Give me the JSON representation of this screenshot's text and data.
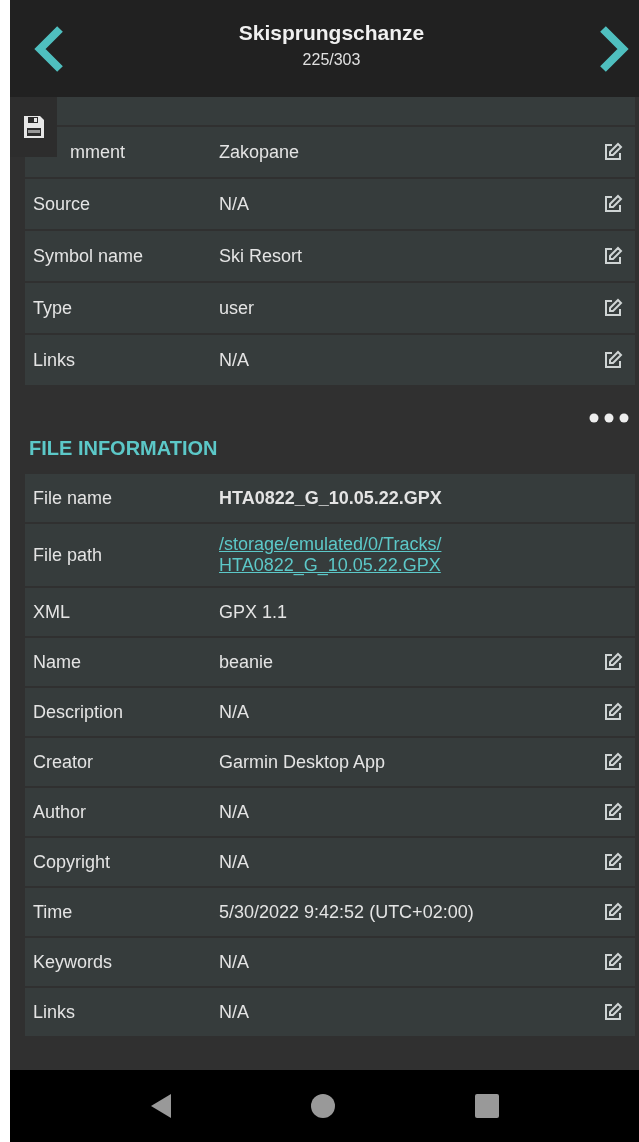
{
  "header": {
    "title": "Skisprungschanze",
    "counter": "225/303"
  },
  "waypoint_rows": [
    {
      "label": "mment",
      "value": "Zakopane",
      "editable": true
    },
    {
      "label": "Source",
      "value": "N/A",
      "editable": true
    },
    {
      "label": "Symbol name",
      "value": "Ski Resort",
      "editable": true
    },
    {
      "label": "Type",
      "value": "user",
      "editable": true
    },
    {
      "label": "Links",
      "value": "N/A",
      "editable": true
    }
  ],
  "file_section": {
    "title": "FILE INFORMATION",
    "rows": [
      {
        "label": "File name",
        "value": "HTA0822_G_10.05.22.GPX",
        "kind": "bold",
        "editable": false
      },
      {
        "label": "File path",
        "value": "/storage/emulated/0/Tracks/ HTA0822_G_10.05.22.GPX",
        "kind": "link",
        "editable": false
      },
      {
        "label": "XML",
        "value": "GPX 1.1",
        "kind": "plain",
        "editable": false
      },
      {
        "label": "Name",
        "value": "beanie",
        "kind": "plain",
        "editable": true
      },
      {
        "label": "Description",
        "value": "N/A",
        "kind": "plain",
        "editable": true
      },
      {
        "label": "Creator",
        "value": "Garmin Desktop App",
        "kind": "plain",
        "editable": true
      },
      {
        "label": "Author",
        "value": "N/A",
        "kind": "plain",
        "editable": true
      },
      {
        "label": "Copyright",
        "value": "N/A",
        "kind": "plain",
        "editable": true
      },
      {
        "label": "Time",
        "value": "5/30/2022 9:42:52  (UTC+02:00)",
        "kind": "plain",
        "editable": true
      },
      {
        "label": "Keywords",
        "value": "N/A",
        "kind": "plain",
        "editable": true
      },
      {
        "label": "Links",
        "value": "N/A",
        "kind": "plain",
        "editable": true
      }
    ]
  }
}
